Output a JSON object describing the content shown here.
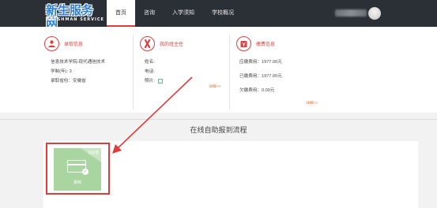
{
  "logo": {
    "main": "新生服务网",
    "sub": "FRESHMAN SERVICE"
  },
  "nav": [
    {
      "label": "首页"
    },
    {
      "label": "咨询"
    },
    {
      "label": "入学须知"
    },
    {
      "label": "学校概况"
    }
  ],
  "info": {
    "admission": {
      "title": "录取信息",
      "lines": [
        "信息技术学院-现代通信技术",
        "学制(年): 3",
        "录取省份：安徽省"
      ]
    },
    "advisor": {
      "title": "我的班主任",
      "name_label": "姓名:",
      "phone_label": "电话:",
      "photo_label": "照片:",
      "more": "详细>>"
    },
    "fees": {
      "title": "缴费信息",
      "due": "应缴费用：1977.00元",
      "paid": "已缴费用：1977.00元",
      "arrears": "欠缴费用：0.00元",
      "more": "详细>>"
    }
  },
  "flow": {
    "title": "在线自助报到流程",
    "tile_status": "已办理",
    "tile_label": "报到"
  },
  "colors": {
    "accent_red": "#e03c3c",
    "header_bg": "#2b2f36",
    "tile_green": "#a8d5a0"
  },
  "icons": [
    "user-icon",
    "ribbon-icon",
    "wallet-icon",
    "card-icon"
  ]
}
